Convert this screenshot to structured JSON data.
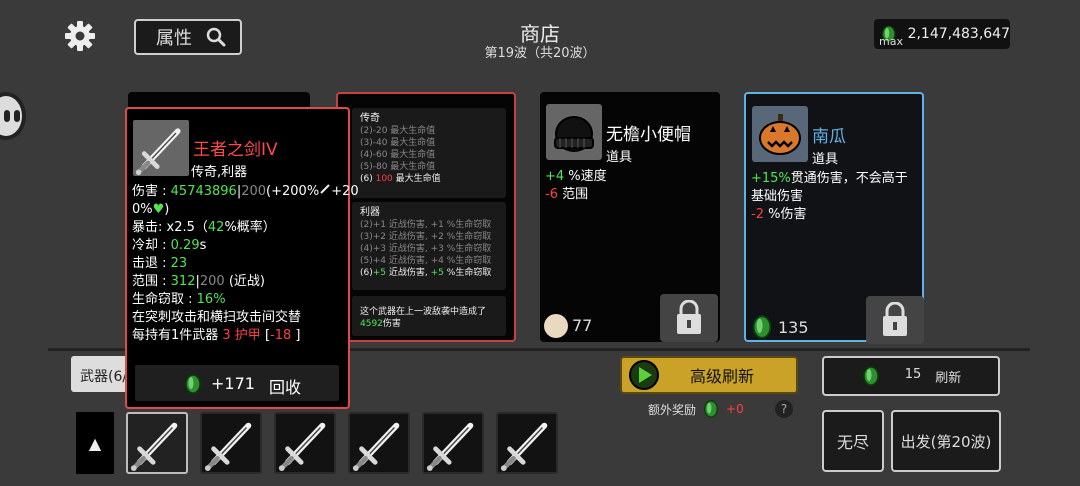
{
  "header": {
    "settings_icon": "gear-icon",
    "attributes_label": "属性",
    "search_icon": "search-icon",
    "title": "商店",
    "wave": "第19波（共20波）",
    "gold": "2,147,483,647",
    "gold_max_label": "max"
  },
  "cards": {
    "card3": {
      "name": "无檐小便帽",
      "type": "道具",
      "stat1_value": "+4",
      "stat1_text": " %速度",
      "stat2_value": "-6",
      "stat2_text": " 范围",
      "price": "77"
    },
    "card4": {
      "name": "南瓜",
      "type": "道具",
      "stat1_value": "+15%",
      "stat1_text": "贯通伤害，不会高于",
      "stat1_text2": "基础伤害",
      "stat2_value": "-2",
      "stat2_text": " %伤害",
      "price": "135"
    }
  },
  "legend_panel": {
    "title1": "传奇",
    "lines1": [
      "(2)-20 最大生命值",
      "(3)-40 最大生命值",
      "(4)-60 最大生命值",
      "(5)-80 最大生命值"
    ],
    "active1_prefix": "(6) ",
    "active1_value": "100",
    "active1_text": " 最大生命值",
    "title2": "利器",
    "lines2": [
      "(2)+1 近战伤害, +1 %生命窃取",
      "(3)+2 近战伤害, +2 %生命窃取",
      "(4)+3 近战伤害, +3 %生命窃取",
      "(5)+4 近战伤害, +4 %生命窃取"
    ],
    "active2_prefix": "(6)",
    "active2_v1": "+5",
    "active2_mid": " 近战伤害, ",
    "active2_v2": "+5",
    "active2_text": " %生命窃取",
    "note_prefix": "这个武器在上一波敌袭中造成了",
    "note_value": "4592",
    "note_suffix": "伤害"
  },
  "tooltip": {
    "name": "王者之剑IV",
    "subtitle": "传奇,利器",
    "dmg_label": "伤害 : ",
    "dmg_value": "45743896",
    "dmg_base": "200",
    "dmg_bonus": "(+200%",
    "dmg_bonus2": "+20",
    "dmg_bonus3": "0%",
    "crit_label": "暴击:  x2.5（",
    "crit_pct": "42",
    "crit_suffix": "%概率）",
    "cd_label": "冷却 : ",
    "cd_value": "0.29",
    "cd_unit": "s",
    "knock_label": "击退 : ",
    "knock_value": "23",
    "range_label": "范围 : ",
    "range_value": "312",
    "range_base": "200",
    "range_suffix": " (近战)",
    "leech_label": "生命窃取 : ",
    "leech_value": "16%",
    "desc1": "在突刺攻击和横扫攻击间交替",
    "desc2_prefix": "每持有1件武器 ",
    "desc2_value": "3 护甲",
    "desc2_bracket": " [",
    "desc2_total": "-18",
    "desc2_end": " ]",
    "recycle_value": "+171",
    "recycle_label": "回收"
  },
  "bottom": {
    "weapons_tab": "武器(6/",
    "premium_refresh": "高级刷新",
    "extra_reward_label": "额外奖励",
    "extra_reward_value": "+0",
    "help": "?",
    "refresh_cost": "15",
    "refresh_label": "刷新",
    "endless": "无尽",
    "go": "出发(第20波)",
    "collapse": "▲"
  },
  "colors": {
    "legendary": "#ff4a4a",
    "positive": "#52e552",
    "negative": "#ff4040",
    "uncommon": "#5fb3e6",
    "gold": "#3aa63a"
  }
}
